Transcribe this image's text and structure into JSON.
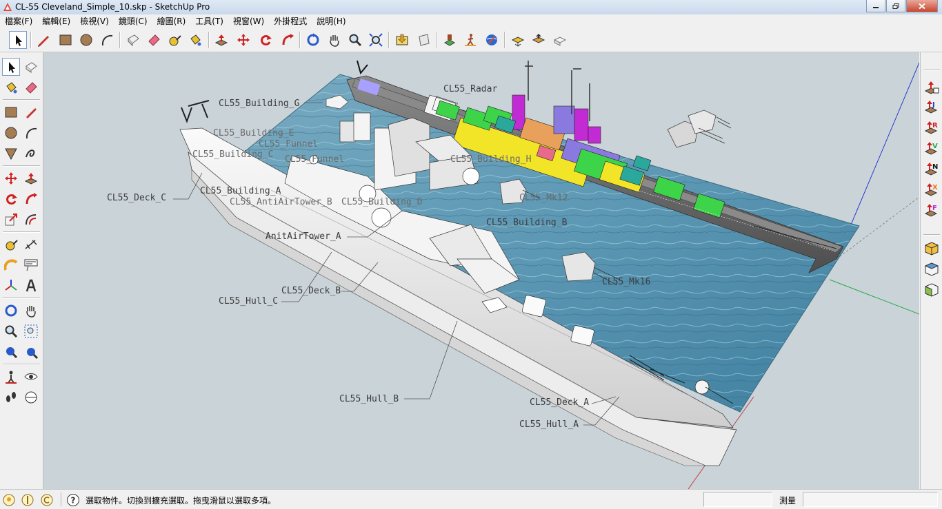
{
  "window": {
    "title": "CL-55 Cleveland_Simple_10.skp - SketchUp Pro"
  },
  "menu": [
    {
      "label": "檔案(F)"
    },
    {
      "label": "編輯(E)"
    },
    {
      "label": "檢視(V)"
    },
    {
      "label": "鏡頭(C)"
    },
    {
      "label": "繪圖(R)"
    },
    {
      "label": "工具(T)"
    },
    {
      "label": "視窗(W)"
    },
    {
      "label": "外掛程式"
    },
    {
      "label": "說明(H)"
    }
  ],
  "toolbar": {
    "tools": [
      "select",
      "pencil",
      "rectangle",
      "circle",
      "arc",
      "eraser-box",
      "eraser",
      "tape-measure",
      "paint-bucket",
      "push-pull",
      "move",
      "rotate",
      "follow-me",
      "orbit",
      "pan",
      "zoom",
      "zoom-extents",
      "components",
      "section",
      "position-camera",
      "walk",
      "get-models",
      "share-model",
      "share-component",
      "extension-warehouse"
    ]
  },
  "right_toolbar": {
    "letters": [
      "",
      "J",
      "R",
      "V",
      "N",
      "X",
      "F"
    ]
  },
  "scene_labels": [
    {
      "text": "CL55_Radar"
    },
    {
      "text": "CL55_Building_G"
    },
    {
      "text": "CL55_Building_E"
    },
    {
      "text": "CL55_Funnel"
    },
    {
      "text": "CL55_Building_C"
    },
    {
      "text": "CL55_Funnel"
    },
    {
      "text": "CL55_Building_H"
    },
    {
      "text": "CL55_Deck_C"
    },
    {
      "text": "CL55_Building_A"
    },
    {
      "text": "CL55_AntiAirTower_B"
    },
    {
      "text": "CL55_Building_D"
    },
    {
      "text": "CL55_Mk12"
    },
    {
      "text": "CL55_Building_B"
    },
    {
      "text": "AnitAirTower_A"
    },
    {
      "text": "CL55_Mk16"
    },
    {
      "text": "CL55_Deck_B"
    },
    {
      "text": "CL55_Hull_C"
    },
    {
      "text": "CL55_Hull_B"
    },
    {
      "text": "CL55_Deck_A"
    },
    {
      "text": "CL55_Hull_A"
    }
  ],
  "status": {
    "hint": "選取物件。切換到擴充選取。拖曳滑鼠以選取多項。",
    "measure_label": "測量",
    "measure_value": ""
  },
  "colors": {
    "viewport_bg": "#c9d3d8",
    "water": "#5a94b0",
    "hull_dark": "#6e6e6e",
    "hull_light": "#f2f2f2",
    "deck_green": "#3ed44a",
    "deck_yellow": "#f2e426",
    "deck_magenta": "#c22ad4",
    "deck_purple": "#8a7ae0",
    "axis_blue": "#2a3ad0",
    "axis_green": "#2aa84a",
    "axis_red": "#c04040"
  }
}
